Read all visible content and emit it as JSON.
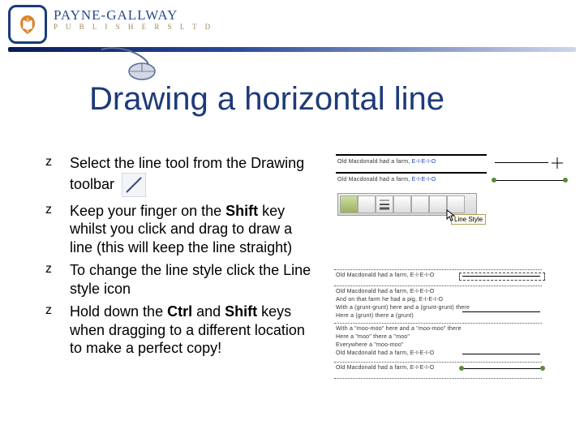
{
  "brand": {
    "top": "PAYNE-GALLWAY",
    "bot": "P U B L I S H E R S   L T D"
  },
  "title": "Drawing a horizontal line",
  "bullets": [
    {
      "seg1": "Select the line tool from the Drawing toolbar",
      "bold1": "",
      "seg2": "",
      "bold2": "",
      "seg3": ""
    },
    {
      "seg1": "Keep your finger on the ",
      "bold1": "Shift",
      "seg2": " key whilst you click and drag to draw a line (this will keep the line straight)",
      "bold2": "",
      "seg3": ""
    },
    {
      "seg1": "To change the line style click the Line style icon",
      "bold1": "",
      "seg2": "",
      "bold2": "",
      "seg3": ""
    },
    {
      "seg1": "Hold down the ",
      "bold1": "Ctrl",
      "seg2": " and ",
      "bold2": "Shift",
      "seg3": " keys when dragging to a different location to make a perfect copy!"
    }
  ],
  "sample": {
    "line1a": "Old Macdonald had a farm, ",
    "line1b": "E-I-E-I-O",
    "line2a": "Old Macdonald had a farm, ",
    "line2b": "E-I-E-I-O",
    "tooltip": "Line Style"
  },
  "sample2": {
    "r1": "Old Macdonald had a farm, E-I-E-I-O",
    "r2": "Old Macdonald had a farm, E-I-E-I-O",
    "r3": "And on that farm he had a pig, E-I-E-I-O",
    "r4": "With a (grunt-grunt) here and a (grunt-grunt) there",
    "r5": "Here a (grunt) there a (grunt)",
    "r6": "With a \"moo-moo\" here and a \"moo-moo\" there",
    "r7": "Here a \"moo\" there a \"moo\"",
    "r8": "Everywhere a \"moo-moo\"",
    "r9": "Old Macdonald had a farm, E-I-E-I-O",
    "r10": "Old Macdonald had a farm, E-I-E-I-O"
  }
}
